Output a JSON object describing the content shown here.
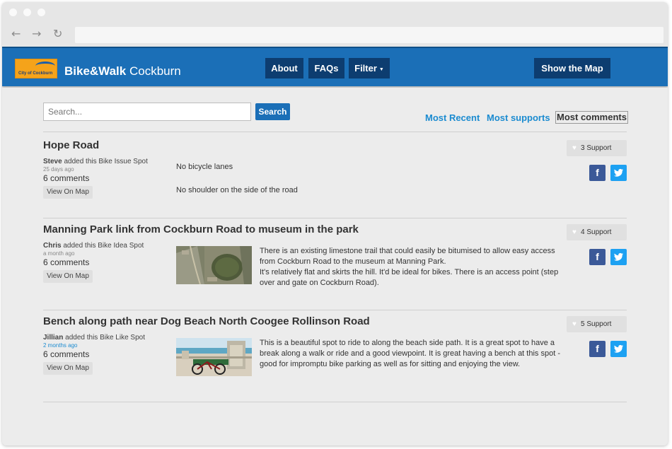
{
  "header": {
    "brand_bold": "Bike&Walk",
    "brand_light": "Cockburn",
    "logo_text": "City of Cockburn",
    "nav": [
      "About",
      "FAQs",
      "Filter"
    ],
    "map_button": "Show the Map"
  },
  "search": {
    "placeholder": "Search...",
    "button": "Search"
  },
  "sort": [
    "Most Recent",
    "Most supports",
    "Most comments"
  ],
  "sort_active": "Most comments",
  "posts": [
    {
      "title": "Hope Road",
      "author": "Steve",
      "action": " added this Bike Issue Spot",
      "ago": "25 days ago",
      "comments": "6 comments",
      "view": "View On Map",
      "support": "3 Support",
      "lines": [
        "No bicycle lanes",
        "No shoulder on the side of the road"
      ]
    },
    {
      "title": "Manning Park link from Cockburn Road to museum in the park",
      "author": "Chris",
      "action": " added this Bike Idea Spot",
      "ago": "a month ago",
      "comments": "6 comments",
      "view": "View On Map",
      "support": "4 Support",
      "text": "There is an existing limestone trail that could easily be bitumised to allow easy access from Cockburn Road to the museum at Manning Park.\nIt's relatively flat and skirts the hill. It'd be ideal for bikes. There is an access point (step over and gate on Cockburn Road)."
    },
    {
      "title": "Bench along path near Dog Beach North Coogee Rollinson Road",
      "author": "Jillian",
      "action": " added this Bike Like Spot",
      "ago": "2 months ago",
      "comments": "6 comments",
      "view": "View On Map",
      "support": "5 Support",
      "text": "This is a beautiful spot to ride to along the beach side path. It is a great spot to have a break along a walk or ride and a good viewpoint. It is great having a bench at this spot - good for impromptu bike parking as well as for sitting and enjoying the view."
    }
  ],
  "colors": {
    "brand_blue": "#1b6fb7",
    "nav_dark": "#0d3d70",
    "link_blue": "#1b8bd0",
    "facebook": "#3b5998",
    "twitter": "#1da1f2",
    "logo_orange": "#f5a31a"
  }
}
